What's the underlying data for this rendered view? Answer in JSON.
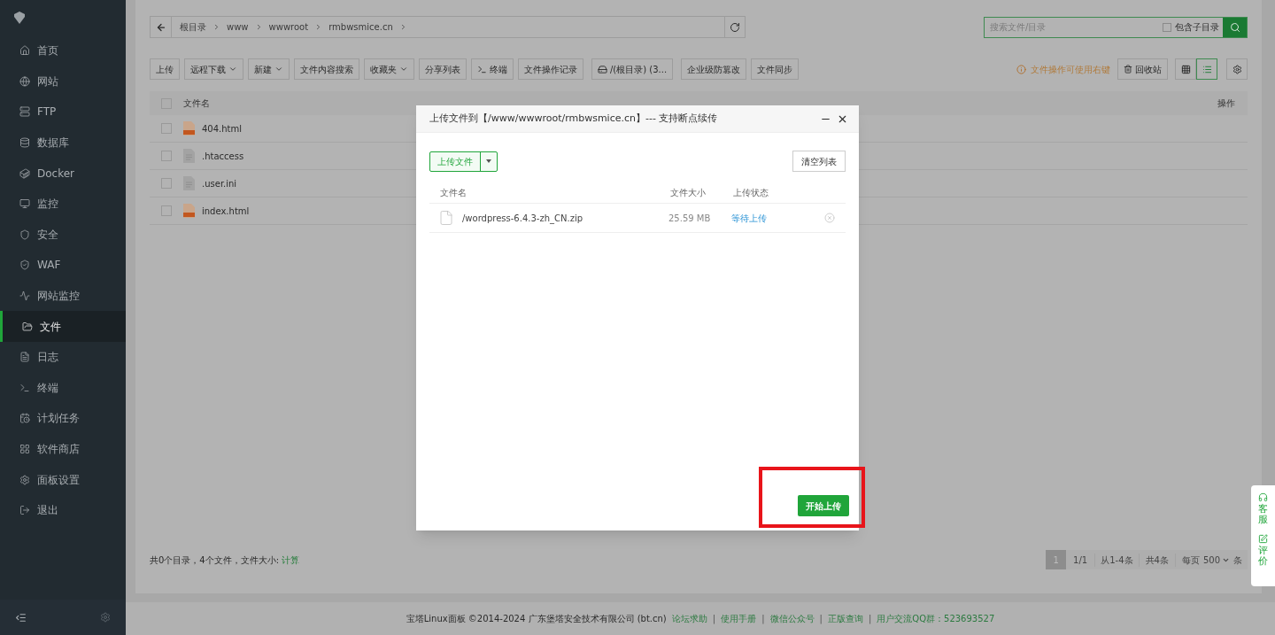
{
  "sidebar": {
    "items": [
      {
        "label": "首页",
        "selected": false
      },
      {
        "label": "网站",
        "selected": false
      },
      {
        "label": "FTP",
        "selected": false
      },
      {
        "label": "数据库",
        "selected": false
      },
      {
        "label": "Docker",
        "selected": false
      },
      {
        "label": "监控",
        "selected": false
      },
      {
        "label": "安全",
        "selected": false
      },
      {
        "label": "WAF",
        "selected": false
      },
      {
        "label": "网站监控",
        "selected": false
      },
      {
        "label": "文件",
        "selected": true
      },
      {
        "label": "日志",
        "selected": false
      },
      {
        "label": "终端",
        "selected": false
      },
      {
        "label": "计划任务",
        "selected": false
      },
      {
        "label": "软件商店",
        "selected": false
      },
      {
        "label": "面板设置",
        "selected": false
      },
      {
        "label": "退出",
        "selected": false
      }
    ]
  },
  "breadcrumb": [
    "根目录",
    "www",
    "wwwroot",
    "rmbwsmice.cn"
  ],
  "search": {
    "placeholder": "搜索文件/目录",
    "include_subdirs": {
      "label": "包含子目录",
      "checked": false
    }
  },
  "toolbar": [
    {
      "label": "上传",
      "kind": "plain"
    },
    {
      "label": "远程下载",
      "kind": "dropdown"
    },
    {
      "label": "新建",
      "kind": "dropdown"
    },
    {
      "label": "文件内容搜索",
      "kind": "plain"
    },
    {
      "label": "收藏夹",
      "kind": "dropdown"
    },
    {
      "label": "分享列表",
      "kind": "plain"
    },
    {
      "label": "终端",
      "kind": "terminal"
    },
    {
      "label": "文件操作记录",
      "kind": "plain"
    },
    {
      "label": "/(根目录) (3...",
      "kind": "disk"
    },
    {
      "label": "企业级防篡改",
      "kind": "plain"
    },
    {
      "label": "文件同步",
      "kind": "plain"
    }
  ],
  "hint": "文件操作可使用右键",
  "recycle_bin": "回收站",
  "view_mode": {
    "grid_selected": false,
    "list_selected": true
  },
  "table": {
    "select_all_checked": false,
    "columns": [
      "文件名",
      "操作"
    ],
    "rows": [
      {
        "name": "404.html",
        "kind": "html",
        "checked": false
      },
      {
        "name": ".htaccess",
        "kind": "text",
        "checked": false
      },
      {
        "name": ".user.ini",
        "kind": "text",
        "checked": false
      },
      {
        "name": "index.html",
        "kind": "html",
        "checked": false
      }
    ]
  },
  "summary": {
    "text": "共0个目录，4个文件，文件大小:",
    "link": "计算"
  },
  "pagination": {
    "current": "1",
    "pages": "1/1",
    "range": "从1-4条",
    "total": "共4条",
    "per_page_label": "每页",
    "per_page": "500",
    "unit": "条"
  },
  "footer": {
    "copyright": "宝塔Linux面板 ©2014-2024 广东堡塔安全技术有限公司 (bt.cn)",
    "separator": "|",
    "links": [
      "论坛求助",
      "使用手册",
      "微信公众号",
      "正版查询",
      "用户交流QQ群：523693527"
    ]
  },
  "side_widget": [
    "客服",
    "评价"
  ],
  "modal": {
    "title": "上传文件到【/www/wwwroot/rmbwsmice.cn】--- 支持断点续传",
    "upload_button": "上传文件",
    "clear_button": "清空列表",
    "columns": [
      "文件名",
      "文件大小",
      "上传状态"
    ],
    "files": [
      {
        "name": "/wordpress-6.4.3-zh_CN.zip",
        "size": "25.59 MB",
        "status": "等待上传"
      }
    ],
    "start_button": "开始上传",
    "highlighted": true
  }
}
